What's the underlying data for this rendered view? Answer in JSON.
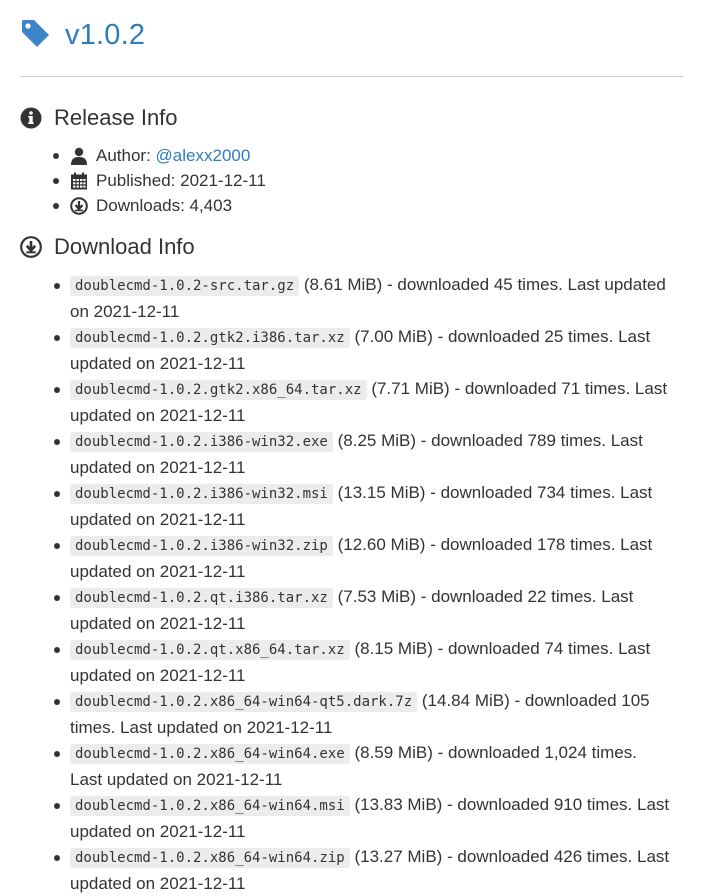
{
  "release": {
    "version": "v1.0.2"
  },
  "release_info": {
    "title": "Release Info",
    "author_label": "Author:",
    "author_link": "@alexx2000",
    "published_label": "Published: 2021-12-11",
    "downloads_label": "Downloads: 4,403"
  },
  "download_info": {
    "title": "Download Info",
    "files": [
      {
        "name": "doublecmd-1.0.2-src.tar.gz",
        "details": "(8.61 MiB) - downloaded 45 times. Last updated on 2021-12-11"
      },
      {
        "name": "doublecmd-1.0.2.gtk2.i386.tar.xz",
        "details": "(7.00 MiB) - downloaded 25 times. Last updated on 2021-12-11"
      },
      {
        "name": "doublecmd-1.0.2.gtk2.x86_64.tar.xz",
        "details": "(7.71 MiB) - downloaded 71 times. Last updated on 2021-12-11"
      },
      {
        "name": "doublecmd-1.0.2.i386-win32.exe",
        "details": "(8.25 MiB) - downloaded 789 times. Last updated on 2021-12-11"
      },
      {
        "name": "doublecmd-1.0.2.i386-win32.msi",
        "details": "(13.15 MiB) - downloaded 734 times. Last updated on 2021-12-11"
      },
      {
        "name": "doublecmd-1.0.2.i386-win32.zip",
        "details": "(12.60 MiB) - downloaded 178 times. Last updated on 2021-12-11"
      },
      {
        "name": "doublecmd-1.0.2.qt.i386.tar.xz",
        "details": "(7.53 MiB) - downloaded 22 times. Last updated on 2021-12-11"
      },
      {
        "name": "doublecmd-1.0.2.qt.x86_64.tar.xz",
        "details": "(8.15 MiB) - downloaded 74 times. Last updated on 2021-12-11"
      },
      {
        "name": "doublecmd-1.0.2.x86_64-win64-qt5.dark.7z",
        "details": "(14.84 MiB) - downloaded 105 times. Last updated on 2021-12-11"
      },
      {
        "name": "doublecmd-1.0.2.x86_64-win64.exe",
        "details": "(8.59 MiB) - downloaded 1,024 times. Last updated on 2021-12-11"
      },
      {
        "name": "doublecmd-1.0.2.x86_64-win64.msi",
        "details": "(13.83 MiB) - downloaded 910 times. Last updated on 2021-12-11"
      },
      {
        "name": "doublecmd-1.0.2.x86_64-win64.zip",
        "details": "(13.27 MiB) - downloaded 426 times. Last updated on 2021-12-11"
      }
    ]
  },
  "colors": {
    "link": "#2f7cbf",
    "tag_icon": "#3a86c8",
    "text": "#333333",
    "code_bg": "#ececec"
  },
  "icons": {
    "tag": "tag-icon",
    "info": "info-circle-icon",
    "user": "user-icon",
    "calendar": "calendar-icon",
    "download": "download-circle-icon"
  }
}
